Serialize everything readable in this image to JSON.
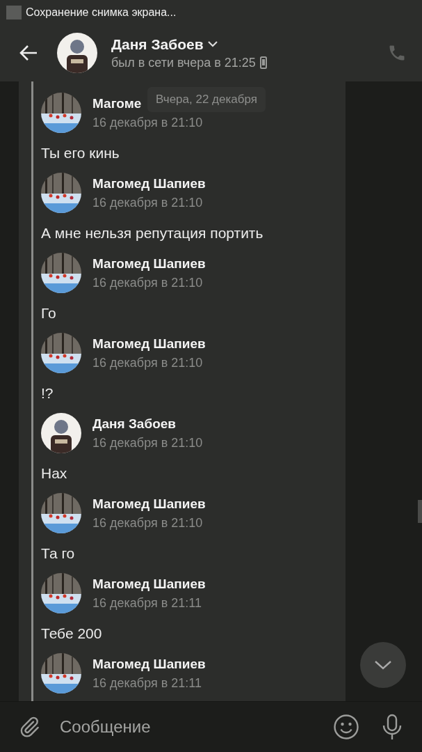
{
  "status_bar": {
    "notification": "Сохранение снимка экрана..."
  },
  "header": {
    "name": "Даня Забоев",
    "status": "был в сети вчера в 21:25",
    "avatar": {
      "kind": "figure"
    }
  },
  "date_pill": "Вчера, 22 декабря",
  "messages": [
    {
      "author": "Магоме",
      "time": "16 декабря в 21:10",
      "text": "Ты его кинь",
      "avatar": {
        "kind": "snow"
      }
    },
    {
      "author": "Магомед Шапиев",
      "time": "16 декабря в 21:10",
      "text": "А мне нельзя репутация портить",
      "avatar": {
        "kind": "snow"
      }
    },
    {
      "author": "Магомед Шапиев",
      "time": "16 декабря в 21:10",
      "text": "Го",
      "avatar": {
        "kind": "snow"
      }
    },
    {
      "author": "Магомед Шапиев",
      "time": "16 декабря в 21:10",
      "text": "!?",
      "avatar": {
        "kind": "snow"
      }
    },
    {
      "author": "Даня Забоев",
      "time": "16 декабря в 21:10",
      "text": "Нах",
      "avatar": {
        "kind": "figure"
      }
    },
    {
      "author": "Магомед Шапиев",
      "time": "16 декабря в 21:10",
      "text": "Та го",
      "avatar": {
        "kind": "snow"
      }
    },
    {
      "author": "Магомед Шапиев",
      "time": "16 декабря в 21:11",
      "text": "Тебе 200",
      "avatar": {
        "kind": "snow"
      }
    },
    {
      "author": "Магомед Шапиев",
      "time": "16 декабря в 21:11",
      "avatar": {
        "kind": "snow"
      }
    }
  ],
  "composer": {
    "placeholder": "Сообщение"
  }
}
